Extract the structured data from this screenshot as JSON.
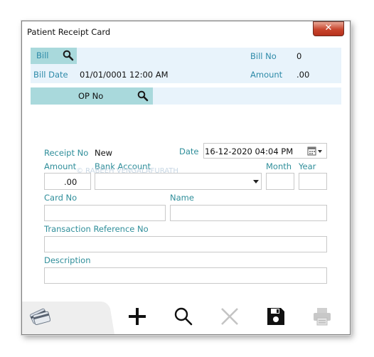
{
  "window": {
    "title": "Patient Receipt Card",
    "close_glyph": "✕"
  },
  "bill_section": {
    "bill_label": "Bill",
    "bill_no_label": "Bill No",
    "bill_no_value": "0",
    "bill_date_label": "Bill Date",
    "bill_date_value": "01/01/0001 12:00 AM",
    "amount_label": "Amount",
    "amount_value": ".00"
  },
  "op_section": {
    "op_no_label": "OP No"
  },
  "form": {
    "receipt_no_label": "Receipt No",
    "receipt_no_value": "New",
    "date_label": "Date",
    "date_value": "16-12-2020 04:04 PM",
    "amount_label": "Amount",
    "amount_value": ".00",
    "bank_account_label": "Bank Account",
    "month_label": "Month",
    "year_label": "Year",
    "card_no_label": "Card No",
    "name_label": "Name",
    "transaction_ref_label": "Transaction Reference No",
    "description_label": "Description",
    "watermark": "© RABEEH VENGALAFURATH"
  },
  "toolbar": {
    "icons": [
      "card-icon",
      "add-icon",
      "search-icon",
      "delete-icon",
      "save-icon",
      "print-icon"
    ]
  },
  "colors": {
    "accent": "#2d8aa8",
    "band": "#e8f3fb",
    "teal": "#a9d9dc",
    "close": "#c8452d"
  }
}
